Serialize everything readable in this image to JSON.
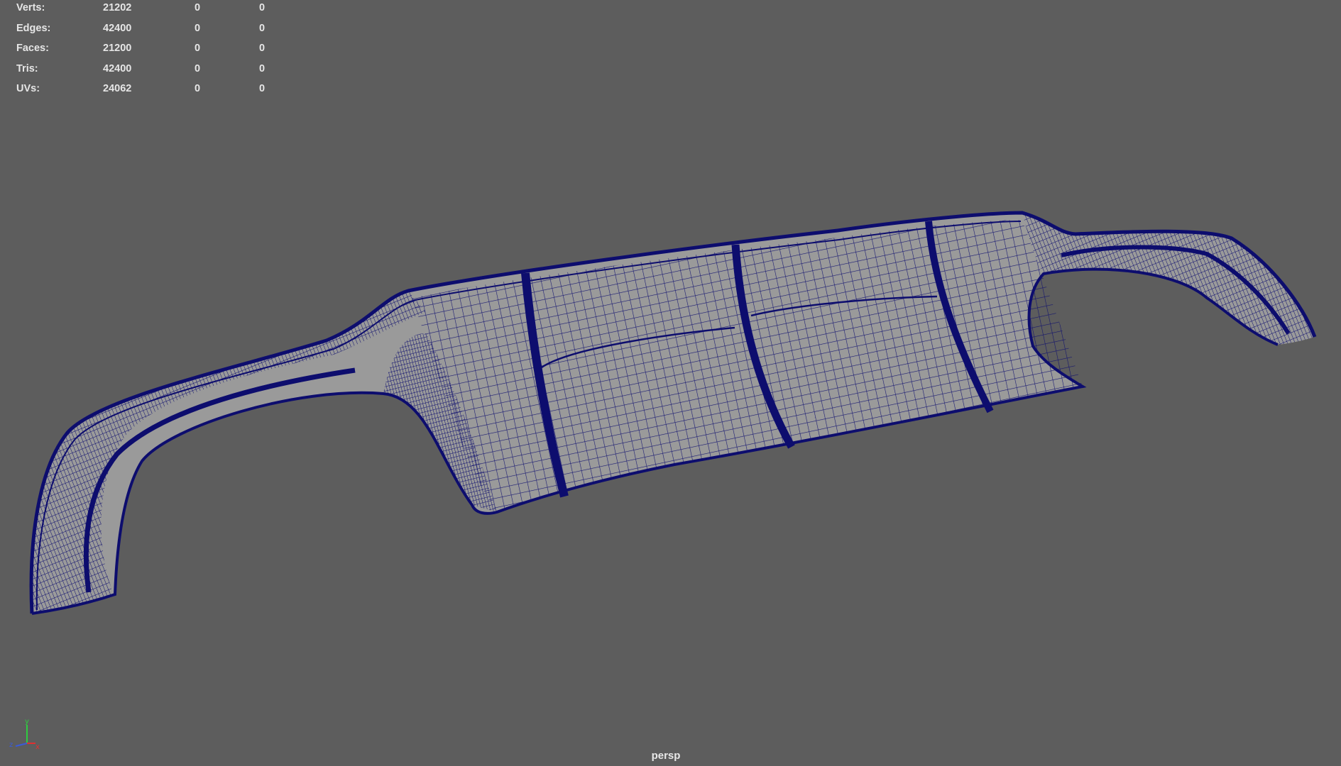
{
  "viewport": {
    "camera": "persp",
    "background_color": "#5d5d5d",
    "wireframe_color": "#0d0d6e",
    "surface_color": "#9a9a9a"
  },
  "hud": {
    "rows": [
      {
        "label": "Verts:",
        "v1": "21202",
        "v2": "0",
        "v3": "0"
      },
      {
        "label": "Edges:",
        "v1": "42400",
        "v2": "0",
        "v3": "0"
      },
      {
        "label": "Faces:",
        "v1": "21200",
        "v2": "0",
        "v3": "0"
      },
      {
        "label": "Tris:",
        "v1": "42400",
        "v2": "0",
        "v3": "0"
      },
      {
        "label": "UVs:",
        "v1": "24062",
        "v2": "0",
        "v3": "0"
      }
    ]
  },
  "axis_gizmo": {
    "x": "x",
    "y": "y",
    "z": "z"
  }
}
